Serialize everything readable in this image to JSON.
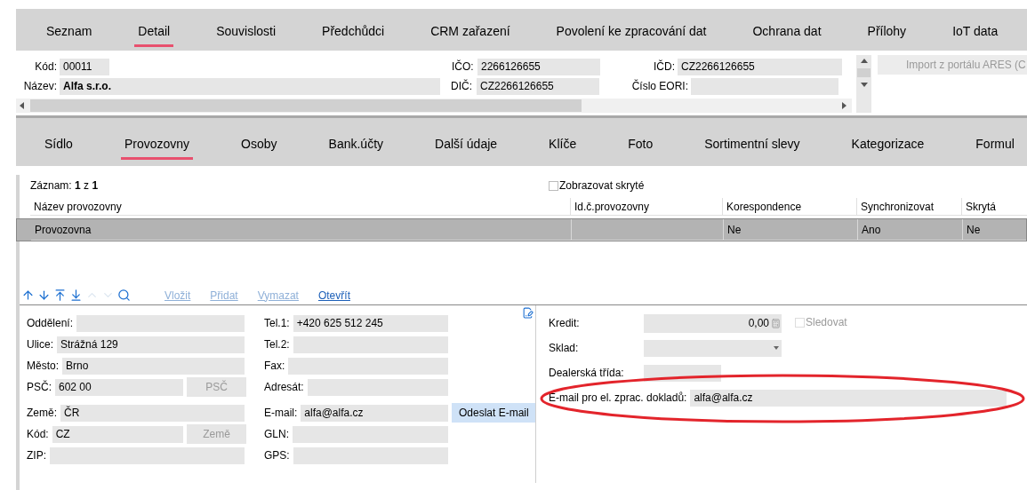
{
  "top_tabs": [
    {
      "label": "Seznam",
      "selected": false
    },
    {
      "label": "Detail",
      "selected": true
    },
    {
      "label": "Souvislosti",
      "selected": false
    },
    {
      "label": "Předchůdci",
      "selected": false
    },
    {
      "label": "CRM zařazení",
      "selected": false
    },
    {
      "label": "Povolení ke zpracování dat",
      "selected": false
    },
    {
      "label": "Ochrana dat",
      "selected": false
    },
    {
      "label": "Přílohy",
      "selected": false
    },
    {
      "label": "IoT data",
      "selected": false
    }
  ],
  "header": {
    "code": {
      "label": "Kód:",
      "value": "00011"
    },
    "name": {
      "label": "Název:",
      "value": "Alfa s.r.o."
    },
    "ico": {
      "label": "IČO:",
      "value": "2266126655"
    },
    "dic": {
      "label": "DIČ:",
      "value": "CZ2266126655"
    },
    "icd": {
      "label": "IČD:",
      "value": "CZ2266126655"
    },
    "eori": {
      "label": "Číslo EORI:"
    },
    "import_button": {
      "label": "Import z portálu ARES (C",
      "disabled": true
    }
  },
  "sub_tabs": [
    {
      "label": "Sídlo",
      "selected": false
    },
    {
      "label": "Provozovny",
      "selected": true
    },
    {
      "label": "Osoby",
      "selected": false
    },
    {
      "label": "Bank.účty",
      "selected": false
    },
    {
      "label": "Další údaje",
      "selected": false
    },
    {
      "label": "Klíče",
      "selected": false
    },
    {
      "label": "Foto",
      "selected": false
    },
    {
      "label": "Sortimentní slevy",
      "selected": false
    },
    {
      "label": "Kategorizace",
      "selected": false
    },
    {
      "label": "Formul",
      "selected": false
    }
  ],
  "record_count": "Záznam: **1** z **1**",
  "show_hidden": {
    "label": "Zobrazovat skryté",
    "checked": false
  },
  "table": {
    "columns": [
      "Název provozovny",
      "Id.č.provozovny",
      "Korespondence",
      "Synchronizovat",
      "Skrytá"
    ],
    "rows": [
      {
        "cells": [
          "Provozovna",
          "",
          "Ne",
          "Ano",
          "Ne"
        ],
        "selected": true
      }
    ]
  },
  "nav_buttons": [
    {
      "kind": "up",
      "disabled": false
    },
    {
      "kind": "down",
      "disabled": false
    },
    {
      "kind": "first",
      "disabled": false
    },
    {
      "kind": "last",
      "disabled": false
    },
    {
      "kind": "prev",
      "disabled": true
    },
    {
      "kind": "next",
      "disabled": true
    },
    {
      "kind": "search",
      "disabled": false
    }
  ],
  "actions": [
    {
      "label": "Vložit",
      "disabled": true
    },
    {
      "label": "Přidat",
      "disabled": true
    },
    {
      "label": "Vymazat",
      "disabled": true
    },
    {
      "label": "Otevřít",
      "disabled": false
    }
  ],
  "form": {
    "left": [
      [
        {
          "label": "Oddělení:"
        },
        {
          "label": "Ulice:",
          "value": "Strážná 129"
        },
        {
          "label": "Město:",
          "value": "Brno"
        },
        {
          "label": "PSČ:",
          "value": "602 00",
          "button": {
            "label": "PSČ",
            "disabled": true
          }
        }
      ],
      [
        {
          "label": "Země:",
          "value": "ČR"
        },
        {
          "label": "Kód:",
          "value": "CZ",
          "button": {
            "label": "Země",
            "disabled": true
          }
        },
        {
          "label": "ZIP:"
        }
      ]
    ],
    "middle": [
      [
        {
          "label": "Tel.1:",
          "value": "+420 625 512 245"
        },
        {
          "label": "Tel.2:"
        },
        {
          "label": "Fax:"
        },
        {
          "label": "Adresát:"
        }
      ],
      [
        {
          "label": "E-mail:",
          "value": "alfa@alfa.cz",
          "button": {
            "label": "Odeslat E-mail",
            "disabled": false
          }
        },
        {
          "label": "GLN:"
        },
        {
          "label": "GPS:"
        }
      ]
    ],
    "right": [
      {
        "kind": "amount",
        "label": "Kredit:",
        "value": "0,00",
        "checkbox": {
          "label": "Sledovat",
          "checked": false,
          "disabled": true
        }
      },
      {
        "kind": "select",
        "label": "Sklad:"
      },
      {
        "kind": "short",
        "label": "Dealerská třída:"
      },
      {
        "kind": "wide",
        "label": "E-mail pro el. zprac. dokladů:",
        "value": "alfa@alfa.cz",
        "highlighted": true
      }
    ]
  }
}
